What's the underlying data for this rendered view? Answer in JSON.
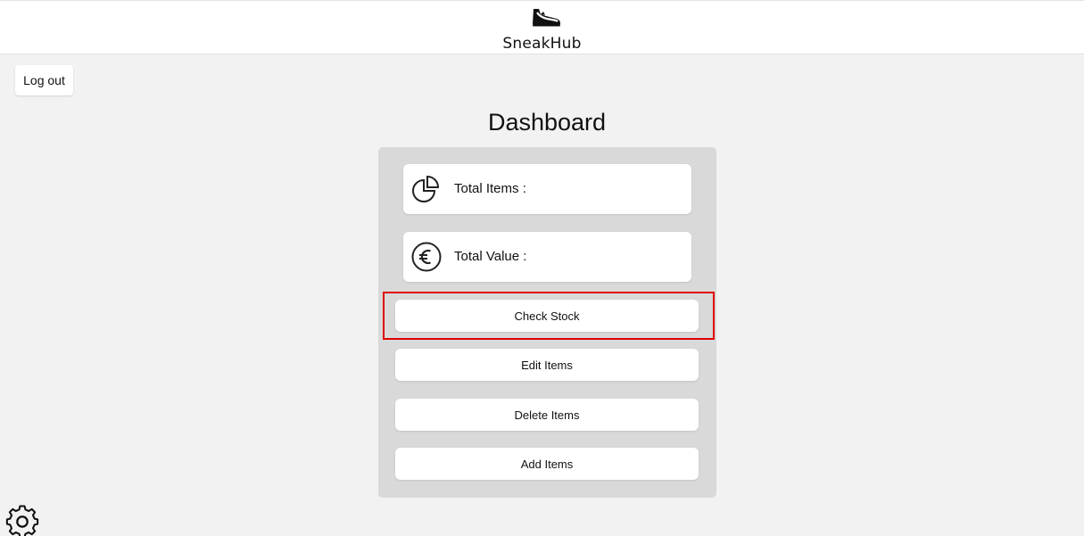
{
  "header": {
    "logo_icon": "sneaker-icon",
    "brand": "SneakHub"
  },
  "logout_label": "Log out",
  "dashboard": {
    "title": "Dashboard",
    "stats": [
      {
        "icon": "pie-chart-icon",
        "label": "Total Items :"
      },
      {
        "icon": "euro-icon",
        "label": "Total Value :"
      }
    ],
    "actions": [
      {
        "label": "Check Stock",
        "highlighted": true
      },
      {
        "label": "Edit Items"
      },
      {
        "label": "Delete Items"
      },
      {
        "label": "Add Items"
      }
    ]
  },
  "settings_icon": "gear-icon",
  "colors": {
    "page_bg": "#f2f2f2",
    "panel_bg": "#d9d9d9",
    "card_bg": "#ffffff",
    "highlight": "#e00000"
  }
}
